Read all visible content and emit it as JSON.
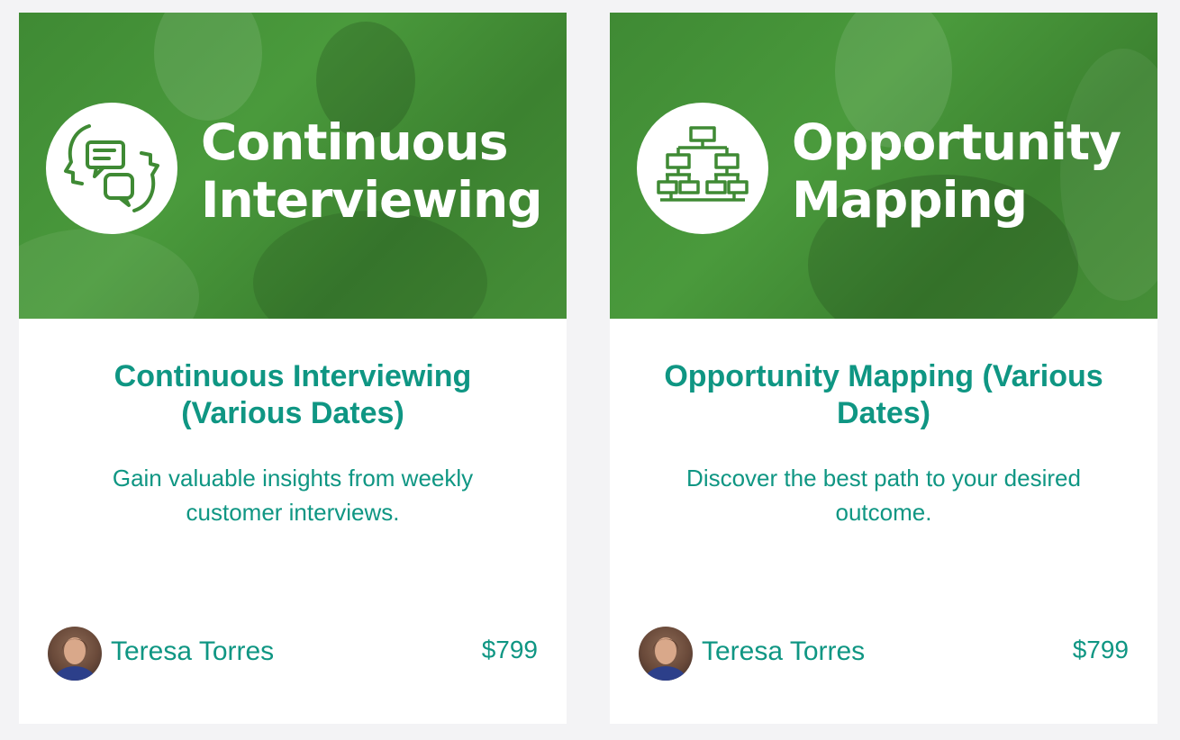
{
  "colors": {
    "background": "#f3f3f5",
    "card": "#ffffff",
    "accent_teal": "#0f9683",
    "banner_green": "#44903a"
  },
  "cards": [
    {
      "banner_line1": "Continuous",
      "banner_line2": "Interviewing",
      "banner_icon": "interview-speech-bubbles-icon",
      "title": "Continuous Interviewing (Various Dates)",
      "description": "Gain valuable insights from weekly customer interviews.",
      "author": "Teresa Torres",
      "price": "$799"
    },
    {
      "banner_line1": "Opportunity",
      "banner_line2": "Mapping",
      "banner_icon": "tree-diagram-icon",
      "title": "Opportunity Mapping (Various Dates)",
      "description": "Discover the best path to your desired outcome.",
      "author": "Teresa Torres",
      "price": "$799"
    }
  ]
}
